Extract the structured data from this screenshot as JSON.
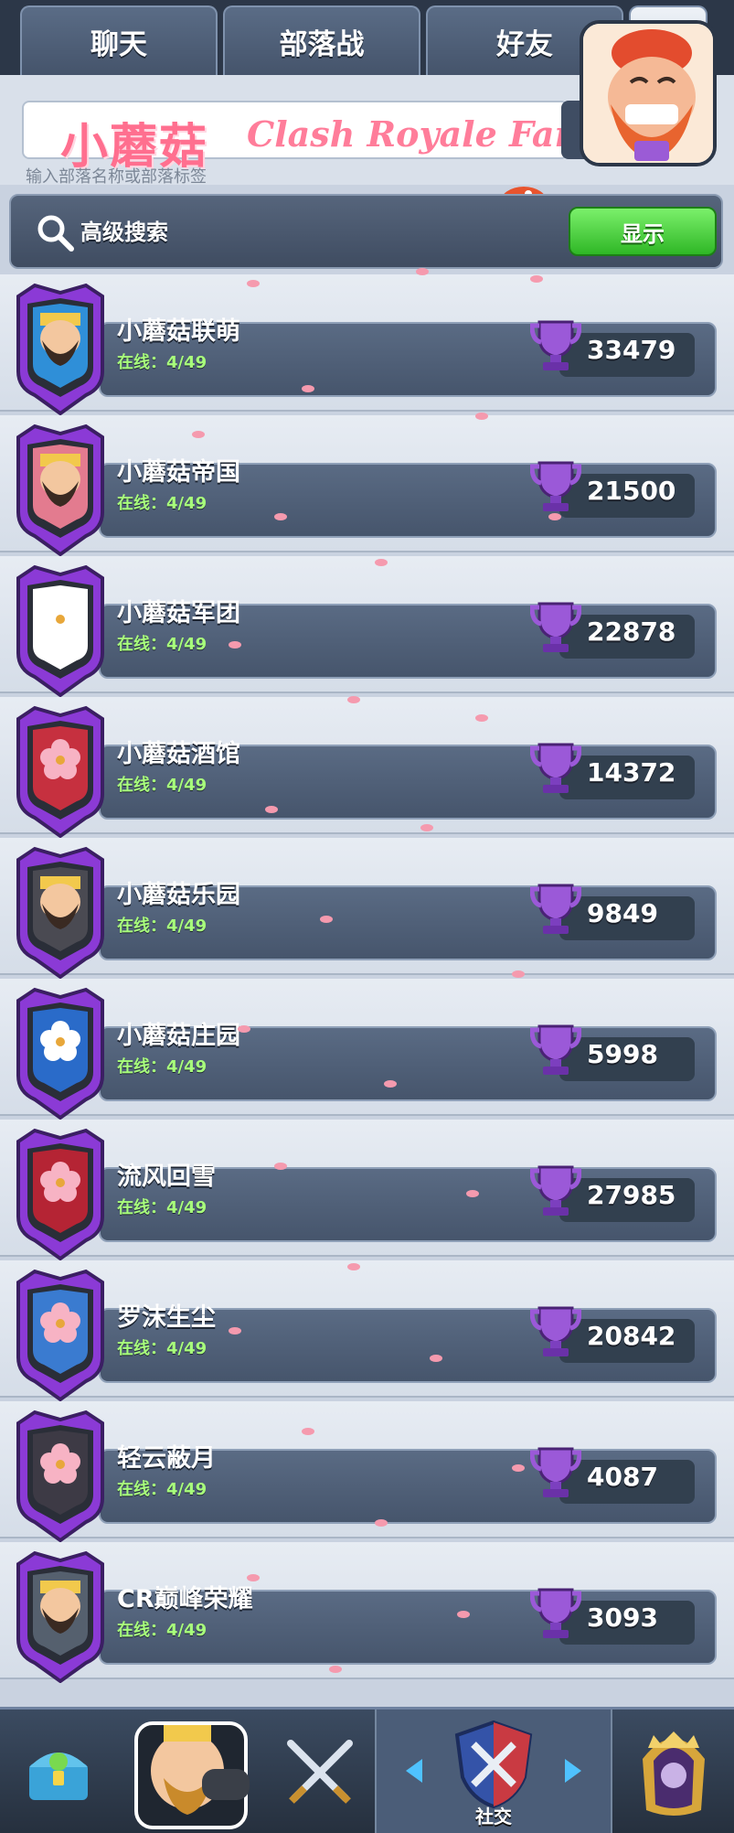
{
  "tabs": [
    {
      "label": "聊天"
    },
    {
      "label": "部落战"
    },
    {
      "label": "好友"
    },
    {
      "label": ""
    }
  ],
  "search": {
    "brand_title": "小蘑菇",
    "brand_sub": "Clash Royale Family",
    "placeholder": "",
    "hint": "输入部落名称或部落标签"
  },
  "advanced": {
    "label": "高级搜索",
    "show_button": "显示"
  },
  "clans": [
    {
      "name": "小蘑菇联萌",
      "online": "在线：4/49",
      "trophies": "33479",
      "badge": "king-blue",
      "color": "#8b3ad6"
    },
    {
      "name": "小蘑菇帝国",
      "online": "在线：4/49",
      "trophies": "21500",
      "badge": "king-pink",
      "color": "#8b3ad6"
    },
    {
      "name": "小蘑菇军团",
      "online": "在线：4/49",
      "trophies": "22878",
      "badge": "flower-white",
      "color": "#8b3ad6"
    },
    {
      "name": "小蘑菇酒馆",
      "online": "在线：4/49",
      "trophies": "14372",
      "badge": "flower-red",
      "color": "#8b3ad6"
    },
    {
      "name": "小蘑菇乐园",
      "online": "在线：4/49",
      "trophies": "9849",
      "badge": "king-dark",
      "color": "#8b3ad6"
    },
    {
      "name": "小蘑菇庄园",
      "online": "在线：4/49",
      "trophies": "5998",
      "badge": "flower-blue",
      "color": "#8b3ad6"
    },
    {
      "name": "流风回雪",
      "online": "在线：4/49",
      "trophies": "27985",
      "badge": "flower-crimson",
      "color": "#8b3ad6"
    },
    {
      "name": "罗沫生尘",
      "online": "在线：4/49",
      "trophies": "20842",
      "badge": "flower-pink-blue",
      "color": "#8b3ad6"
    },
    {
      "name": "轻云蔽月",
      "online": "在线：4/49",
      "trophies": "4087",
      "badge": "flower-pink-dark",
      "color": "#8b3ad6"
    },
    {
      "name": "CR巅峰荣耀",
      "online": "在线：4/49",
      "trophies": "3093",
      "badge": "king-gray",
      "color": "#8b3ad6"
    }
  ],
  "bottom_nav": {
    "social_label": "社交"
  },
  "colors": {
    "accent_green": "#2fb726",
    "badge_purple": "#8b3ad6",
    "brand_pink": "#ff6f8f"
  },
  "icons": [
    "search-icon",
    "trophy-icon",
    "mushroom-icon",
    "chest-icon",
    "swords-icon",
    "shield-icon",
    "arrow-left-icon",
    "arrow-right-icon",
    "crown-icon"
  ]
}
